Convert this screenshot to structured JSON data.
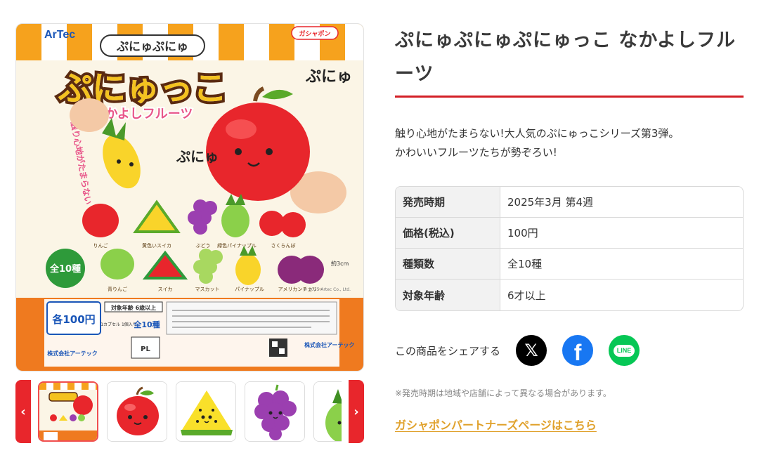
{
  "product": {
    "title": "ぷにゅぷにゅぷにゅっこ なかよしフルーツ",
    "description_line1": "触り心地がたまらない!大人気のぷにゅっこシリーズ第3弾。",
    "description_line2": "かわいいフルーツたちが勢ぞろい!"
  },
  "package_art": {
    "brand": "ArTec",
    "badge": "ガシャポン",
    "series_small": "ぷにゅぷにゅ",
    "series_big": "ぷにゅっこ",
    "subtitle": "なかよしフルーツ",
    "sfx1": "ぷにゅ",
    "sfx2": "ぷにゅ",
    "vertical_text": "触り心地がたまらない",
    "total": "全10種",
    "size_note": "約3cm",
    "copyright": "© 2025 Artec Co., Ltd.",
    "price_label": "各100円",
    "age_label": "対象年齢 6歳以上",
    "capsule_note": "1カプセル 1個入り",
    "count_label": "全10種",
    "pl_mark": "PL",
    "maker": "株式会社アーテック",
    "fruit_names_row1": [
      "りんご",
      "黄色いスイカ",
      "ぶどう",
      "緑色パイナップル",
      "さくらんぼ"
    ],
    "fruit_names_row2": [
      "青りんご",
      "スイカ",
      "マスカット",
      "パイナップル",
      "アメリカンチェリー"
    ]
  },
  "specs": [
    {
      "key": "発売時期",
      "value": "2025年3月 第4週"
    },
    {
      "key": "価格(税込)",
      "value": "100円"
    },
    {
      "key": "種類数",
      "value": "全10種"
    },
    {
      "key": "対象年齢",
      "value": "6才以上"
    }
  ],
  "share": {
    "label": "この商品をシェアする",
    "x_glyph": "𝕏",
    "facebook_glyph": "f",
    "line_glyph": "LINE"
  },
  "note": "※発売時期は地域や店舗によって異なる場合があります。",
  "partner_link": "ガシャポンパートナーズページはこちら",
  "gallery": {
    "prev_glyph": "‹",
    "next_glyph": "›"
  },
  "colors": {
    "accent_red": "#d31f26",
    "link_gold": "#e0a12b",
    "x_black": "#000000",
    "facebook_blue": "#1877f2",
    "line_green": "#06c755"
  }
}
